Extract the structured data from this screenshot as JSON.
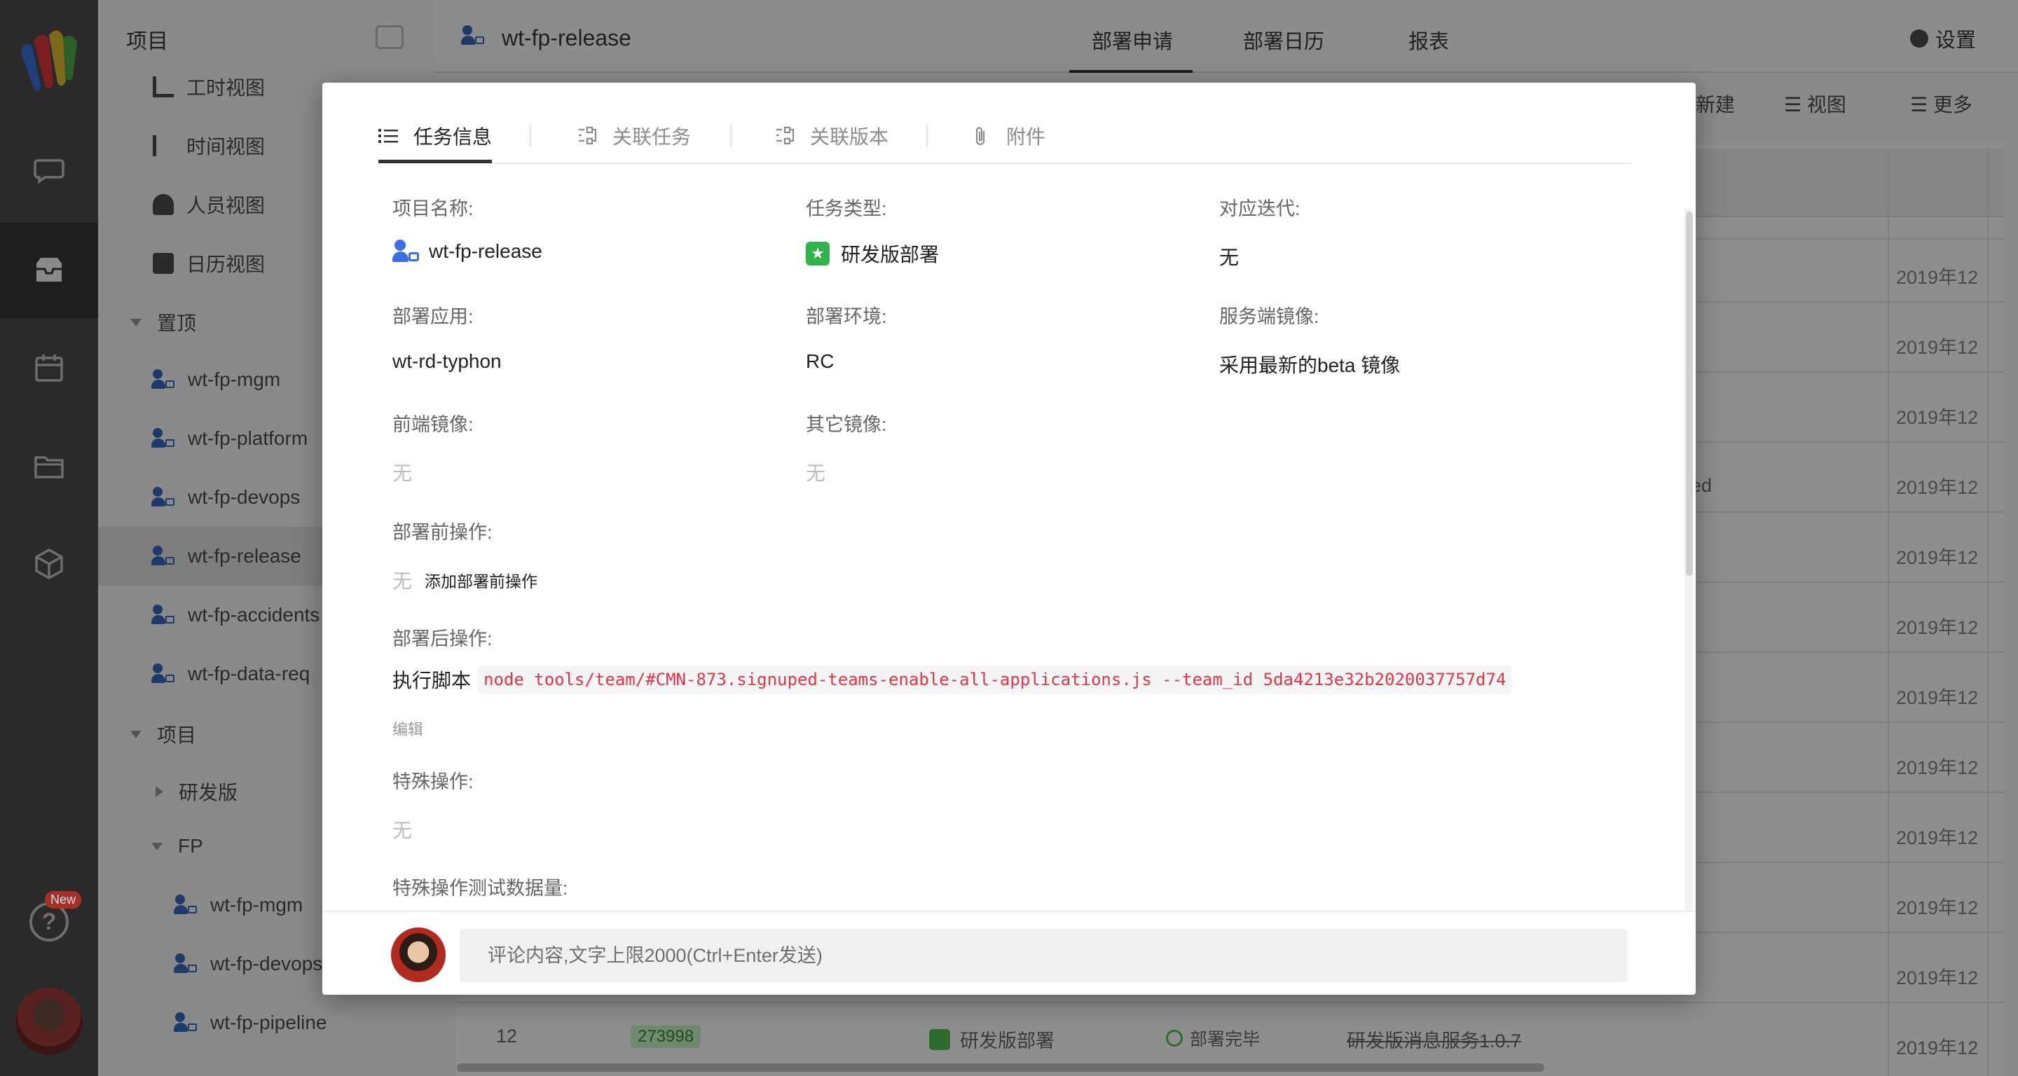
{
  "sidebar": {
    "title": "项目",
    "views": [
      "工时视图",
      "时间视图",
      "人员视图",
      "日历视图"
    ],
    "pinned_group": "置顶",
    "pinned": [
      "wt-fp-mgm",
      "wt-fp-platform",
      "wt-fp-devops",
      "wt-fp-release",
      "wt-fp-accidents",
      "wt-fp-data-req"
    ],
    "projects_group": "项目",
    "sub_group_1": "研发版",
    "sub_group_2": "FP",
    "fp_items": [
      "wt-fp-mgm",
      "wt-fp-devops",
      "wt-fp-pipeline"
    ]
  },
  "rail": {
    "new_badge": "New",
    "help_glyph": "?"
  },
  "topbar": {
    "project_title": "wt-fp-release",
    "tabs": [
      "部署申请",
      "部署日历",
      "报表"
    ],
    "settings": "设置"
  },
  "toolbar": {
    "new": "新建",
    "view": "视图",
    "more": "更多"
  },
  "table": {
    "date_fragment": "2019年12",
    "ed_fragment": "ed",
    "row12": {
      "num": "12",
      "id": "273998",
      "type": "研发版部署",
      "status": "部署完毕",
      "name": "研发版消息服务1.0.7"
    }
  },
  "modal": {
    "tabs": [
      "任务信息",
      "关联任务",
      "关联版本",
      "附件"
    ],
    "fields": {
      "project_name": {
        "label": "项目名称:",
        "value": "wt-fp-release"
      },
      "task_type": {
        "label": "任务类型:",
        "value": "研发版部署"
      },
      "iteration": {
        "label": "对应迭代:",
        "value": "无"
      },
      "deploy_app": {
        "label": "部署应用:",
        "value": "wt-rd-typhon"
      },
      "deploy_env": {
        "label": "部署环境:",
        "value": "RC"
      },
      "server_image": {
        "label": "服务端镜像:",
        "value": "采用最新的beta 镜像"
      },
      "frontend_image": {
        "label": "前端镜像:",
        "value": "无"
      },
      "other_image": {
        "label": "其它镜像:",
        "value": "无"
      },
      "pre_ops": {
        "label": "部署前操作:",
        "value": "无",
        "add": "添加部署前操作"
      },
      "post_ops": {
        "label": "部署后操作:",
        "prefix": "执行脚本",
        "code": "node tools/team/#CMN-873.signuped-teams-enable-all-applications.js --team_id 5da4213e32b2020037757d74",
        "edit": "编辑"
      },
      "special_ops": {
        "label": "特殊操作:",
        "value": "无"
      },
      "special_test_data": {
        "label": "特殊操作测试数据量:"
      }
    },
    "comment_placeholder": "评论内容,文字上限2000(Ctrl+Enter发送)"
  }
}
